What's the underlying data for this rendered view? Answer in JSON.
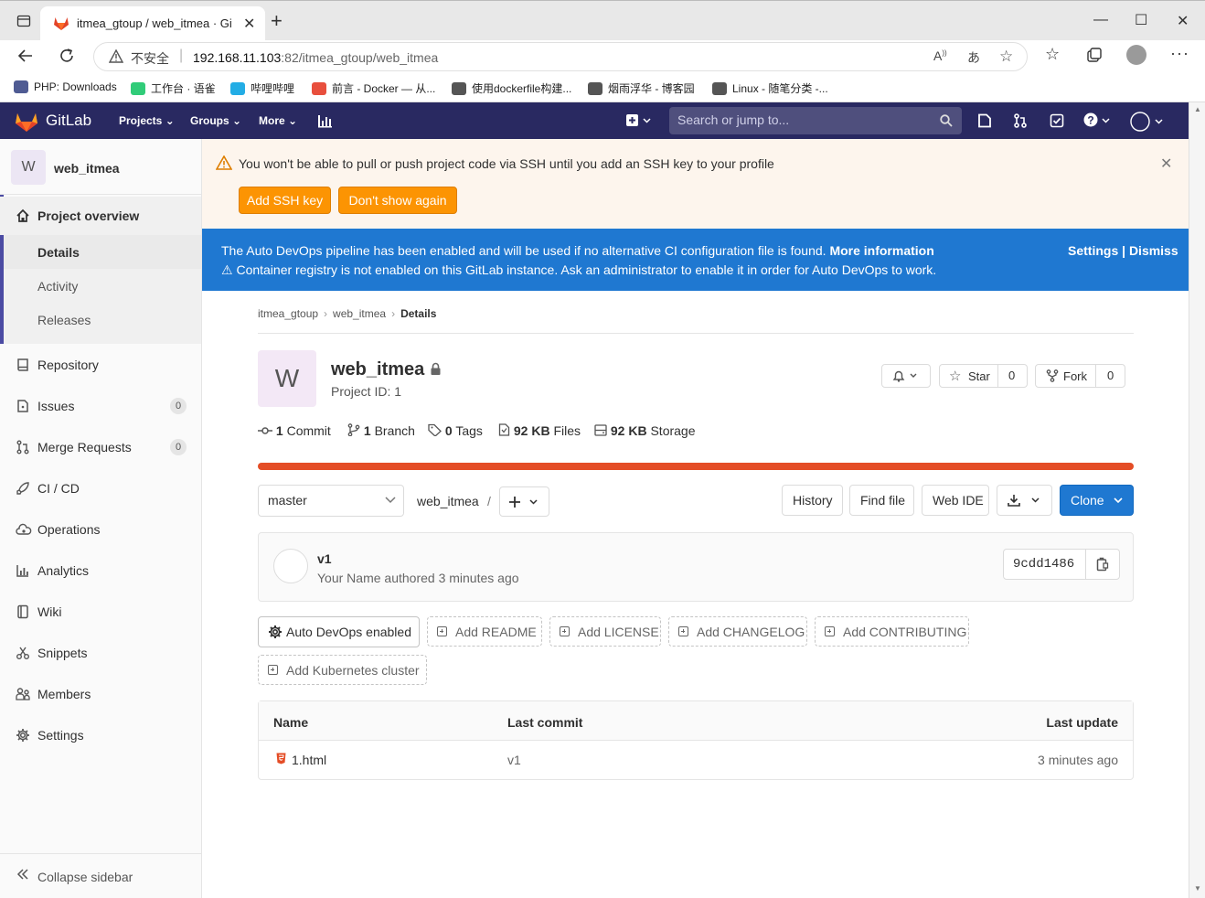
{
  "browser": {
    "tab_title": "itmea_gtoup / web_itmea · GitLab",
    "security_label": "不安全",
    "url_host": "192.168.11.103",
    "url_rest": ":82/itmea_gtoup/web_itmea",
    "bookmarks": [
      {
        "label": "PHP: Downloads",
        "color": "#4f5b93"
      },
      {
        "label": "工作台 · 语雀",
        "color": "#31cc79"
      },
      {
        "label": "哔哩哔哩",
        "color": "#23ade5"
      },
      {
        "label": "前言 - Docker — 从...",
        "color": "#e84f3d"
      },
      {
        "label": "使用dockerfile构建...",
        "color": "#333333"
      },
      {
        "label": "烟雨浮华 - 博客园",
        "color": "#333333"
      },
      {
        "label": "Linux - 随笔分类 -...",
        "color": "#333333"
      }
    ]
  },
  "header": {
    "brand": "GitLab",
    "nav": [
      "Projects",
      "Groups",
      "More"
    ],
    "search_placeholder": "Search or jump to..."
  },
  "sidebar": {
    "project_initial": "W",
    "project_name": "web_itmea",
    "overview": "Project overview",
    "sub_items": [
      "Details",
      "Activity",
      "Releases"
    ],
    "items": [
      {
        "label": "Repository",
        "icon": "book-icon"
      },
      {
        "label": "Issues",
        "icon": "issues-icon",
        "badge": "0"
      },
      {
        "label": "Merge Requests",
        "icon": "merge-request-icon",
        "badge": "0"
      },
      {
        "label": "CI / CD",
        "icon": "rocket-icon"
      },
      {
        "label": "Operations",
        "icon": "cloud-gear-icon"
      },
      {
        "label": "Analytics",
        "icon": "chart-icon"
      },
      {
        "label": "Wiki",
        "icon": "wiki-icon"
      },
      {
        "label": "Snippets",
        "icon": "scissors-icon"
      },
      {
        "label": "Members",
        "icon": "users-icon"
      },
      {
        "label": "Settings",
        "icon": "settings-icon"
      }
    ],
    "collapse": "Collapse sidebar"
  },
  "ssh_alert": {
    "message": "You won't be able to pull or push project code via SSH until you add an SSH key to your profile",
    "add_ssh": "Add SSH key",
    "dont_show": "Don't show again"
  },
  "devops_alert": {
    "line1": "The Auto DevOps pipeline has been enabled and will be used if no alternative CI configuration file is found.",
    "more_info": "More information",
    "line2": "Container registry is not enabled on this GitLab instance. Ask an administrator to enable it in order for Auto DevOps to work.",
    "settings": "Settings",
    "sep": "|",
    "dismiss": "Dismiss"
  },
  "breadcrumb": [
    "itmea_gtoup",
    "web_itmea",
    "Details"
  ],
  "project": {
    "initial": "W",
    "name": "web_itmea",
    "id_label": "Project ID: 1",
    "star": "Star",
    "star_count": "0",
    "fork": "Fork",
    "fork_count": "0"
  },
  "stats": [
    {
      "num": "1",
      "label": "Commit"
    },
    {
      "num": "1",
      "label": "Branch"
    },
    {
      "num": "0",
      "label": "Tags"
    },
    {
      "num": "92 KB",
      "label": "Files"
    },
    {
      "num": "92 KB",
      "label": "Storage"
    }
  ],
  "repo_bar": {
    "branch": "master",
    "path": "web_itmea",
    "path_sep": "/",
    "history": "History",
    "find_file": "Find file",
    "web_ide": "Web IDE",
    "clone": "Clone"
  },
  "last_commit": {
    "message": "v1",
    "meta": "Your Name authored 3 minutes ago",
    "sha": "9cdd1486"
  },
  "actions": [
    "Auto DevOps enabled",
    "Add README",
    "Add LICENSE",
    "Add CHANGELOG",
    "Add CONTRIBUTING",
    "Add Kubernetes cluster"
  ],
  "files": {
    "headers": [
      "Name",
      "Last commit",
      "Last update"
    ],
    "rows": [
      {
        "name": "1.html",
        "commit": "v1",
        "updated": "3 minutes ago"
      }
    ]
  },
  "colors": {
    "header_bg": "#292961",
    "accent_blue": "#1f78d1",
    "warning_orange": "#fc9403",
    "language_bar": "#e44d26"
  }
}
